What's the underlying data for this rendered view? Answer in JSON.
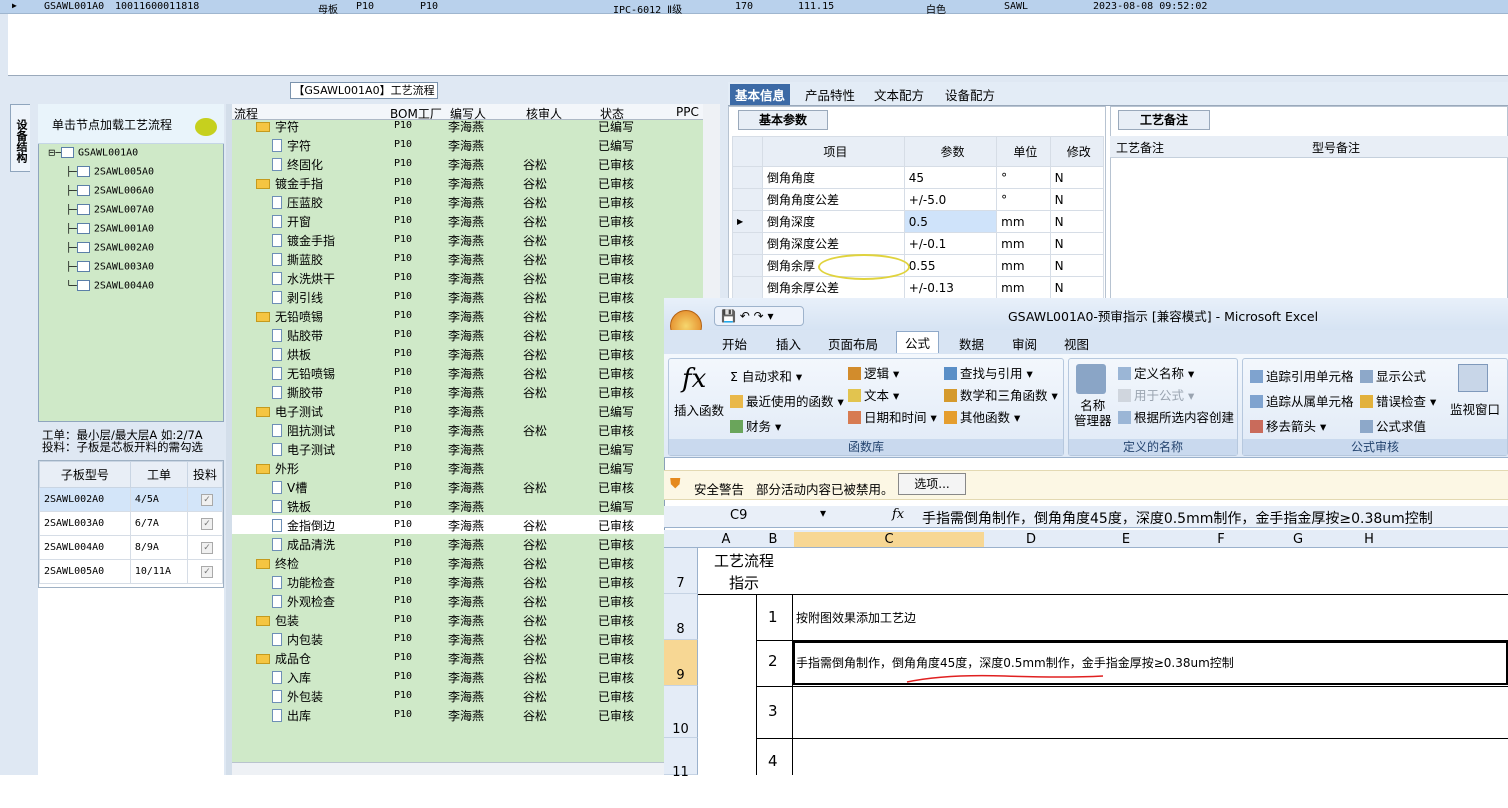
{
  "top_grid": {
    "row": [
      "GSAWL001A0",
      "10011600011818",
      "母板",
      "P10",
      "P10",
      "IPC-6012 Ⅱ级",
      "170",
      "111.15",
      "白色",
      "SAWL",
      "2023-08-08 09:52:02"
    ]
  },
  "left_panel": {
    "title": "【GSAWL001A0】工艺流程",
    "vertical_tab": "设备结构",
    "tree_header": "单击节点加载工艺流程",
    "tree": {
      "root": "GSAWL001A0",
      "children": [
        "2SAWL005A0",
        "2SAWL006A0",
        "2SAWL007A0",
        "2SAWL001A0",
        "2SAWL002A0",
        "2SAWL003A0",
        "2SAWL004A0"
      ]
    },
    "info_line1": "工单：最小层/最大层A 如:2/7A",
    "info_line2": "投料：子板是芯板开料的需勾选",
    "sub_table": {
      "headers": [
        "子板型号",
        "工单",
        "投料"
      ],
      "rows": [
        [
          "2SAWL002A0",
          "4/5A"
        ],
        [
          "2SAWL003A0",
          "6/7A"
        ],
        [
          "2SAWL004A0",
          "8/9A"
        ],
        [
          "2SAWL005A0",
          "10/11A"
        ]
      ]
    }
  },
  "process_grid": {
    "headers": [
      "流程",
      "BOM工厂",
      "编写人",
      "核审人",
      "状态",
      "PPC"
    ],
    "rows": [
      {
        "level": 1,
        "name": "字符",
        "bom": "P10",
        "writer": "李海燕",
        "reviewer": "",
        "status": "已编写"
      },
      {
        "level": 2,
        "name": "字符",
        "bom": "P10",
        "writer": "李海燕",
        "reviewer": "",
        "status": "已编写"
      },
      {
        "level": 2,
        "name": "终固化",
        "bom": "P10",
        "writer": "李海燕",
        "reviewer": "谷松",
        "status": "已审核"
      },
      {
        "level": 1,
        "name": "镀金手指",
        "bom": "P10",
        "writer": "李海燕",
        "reviewer": "谷松",
        "status": "已审核"
      },
      {
        "level": 2,
        "name": "压蓝胶",
        "bom": "P10",
        "writer": "李海燕",
        "reviewer": "谷松",
        "status": "已审核"
      },
      {
        "level": 2,
        "name": "开窗",
        "bom": "P10",
        "writer": "李海燕",
        "reviewer": "谷松",
        "status": "已审核"
      },
      {
        "level": 2,
        "name": "镀金手指",
        "bom": "P10",
        "writer": "李海燕",
        "reviewer": "谷松",
        "status": "已审核"
      },
      {
        "level": 2,
        "name": "撕蓝胶",
        "bom": "P10",
        "writer": "李海燕",
        "reviewer": "谷松",
        "status": "已审核"
      },
      {
        "level": 2,
        "name": "水洗烘干",
        "bom": "P10",
        "writer": "李海燕",
        "reviewer": "谷松",
        "status": "已审核"
      },
      {
        "level": 2,
        "name": "剥引线",
        "bom": "P10",
        "writer": "李海燕",
        "reviewer": "谷松",
        "status": "已审核"
      },
      {
        "level": 1,
        "name": "无铅喷锡",
        "bom": "P10",
        "writer": "李海燕",
        "reviewer": "谷松",
        "status": "已审核"
      },
      {
        "level": 2,
        "name": "贴胶带",
        "bom": "P10",
        "writer": "李海燕",
        "reviewer": "谷松",
        "status": "已审核"
      },
      {
        "level": 2,
        "name": "烘板",
        "bom": "P10",
        "writer": "李海燕",
        "reviewer": "谷松",
        "status": "已审核"
      },
      {
        "level": 2,
        "name": "无铅喷锡",
        "bom": "P10",
        "writer": "李海燕",
        "reviewer": "谷松",
        "status": "已审核"
      },
      {
        "level": 2,
        "name": "撕胶带",
        "bom": "P10",
        "writer": "李海燕",
        "reviewer": "谷松",
        "status": "已审核"
      },
      {
        "level": 1,
        "name": "电子测试",
        "bom": "P10",
        "writer": "李海燕",
        "reviewer": "",
        "status": "已编写"
      },
      {
        "level": 2,
        "name": "阻抗测试",
        "bom": "P10",
        "writer": "李海燕",
        "reviewer": "谷松",
        "status": "已审核"
      },
      {
        "level": 2,
        "name": "电子测试",
        "bom": "P10",
        "writer": "李海燕",
        "reviewer": "",
        "status": "已编写"
      },
      {
        "level": 1,
        "name": "外形",
        "bom": "P10",
        "writer": "李海燕",
        "reviewer": "",
        "status": "已编写"
      },
      {
        "level": 2,
        "name": "V槽",
        "bom": "P10",
        "writer": "李海燕",
        "reviewer": "谷松",
        "status": "已审核"
      },
      {
        "level": 2,
        "name": "铣板",
        "bom": "P10",
        "writer": "李海燕",
        "reviewer": "",
        "status": "已编写"
      },
      {
        "level": 2,
        "name": "金指倒边",
        "bom": "P10",
        "writer": "李海燕",
        "reviewer": "谷松",
        "status": "已审核",
        "selected": true
      },
      {
        "level": 2,
        "name": "成品清洗",
        "bom": "P10",
        "writer": "李海燕",
        "reviewer": "谷松",
        "status": "已审核"
      },
      {
        "level": 1,
        "name": "终检",
        "bom": "P10",
        "writer": "李海燕",
        "reviewer": "谷松",
        "status": "已审核"
      },
      {
        "level": 2,
        "name": "功能检查",
        "bom": "P10",
        "writer": "李海燕",
        "reviewer": "谷松",
        "status": "已审核"
      },
      {
        "level": 2,
        "name": "外观检查",
        "bom": "P10",
        "writer": "李海燕",
        "reviewer": "谷松",
        "status": "已审核"
      },
      {
        "level": 1,
        "name": "包装",
        "bom": "P10",
        "writer": "李海燕",
        "reviewer": "谷松",
        "status": "已审核"
      },
      {
        "level": 2,
        "name": "内包装",
        "bom": "P10",
        "writer": "李海燕",
        "reviewer": "谷松",
        "status": "已审核"
      },
      {
        "level": 1,
        "name": "成品仓",
        "bom": "P10",
        "writer": "李海燕",
        "reviewer": "谷松",
        "status": "已审核"
      },
      {
        "level": 2,
        "name": "入库",
        "bom": "P10",
        "writer": "李海燕",
        "reviewer": "谷松",
        "status": "已审核"
      },
      {
        "level": 2,
        "name": "外包装",
        "bom": "P10",
        "writer": "李海燕",
        "reviewer": "谷松",
        "status": "已审核"
      },
      {
        "level": 2,
        "name": "出库",
        "bom": "P10",
        "writer": "李海燕",
        "reviewer": "谷松",
        "status": "已审核"
      }
    ]
  },
  "right_panel": {
    "tabs": [
      "基本信息",
      "产品特性",
      "文本配方",
      "设备配方"
    ],
    "params_tab": "基本参数",
    "params_headers": [
      "项目",
      "参数",
      "单位",
      "修改"
    ],
    "params_rows": [
      [
        "倒角角度",
        "45",
        "°",
        "N"
      ],
      [
        "倒角角度公差",
        "+/-5.0",
        "°",
        "N"
      ],
      [
        "倒角深度",
        "0.5",
        "mm",
        "N"
      ],
      [
        "倒角深度公差",
        "+/-0.1",
        "mm",
        "N"
      ],
      [
        "倒角余厚",
        "0.55",
        "mm",
        "N"
      ],
      [
        "倒角余厚公差",
        "+/-0.13",
        "mm",
        "N"
      ]
    ],
    "notes_tab": "工艺备注",
    "notes_headers": [
      "工艺备注",
      "型号备注"
    ]
  },
  "excel": {
    "title": "GSAWL001A0-预审指示 [兼容模式] - Microsoft Excel",
    "tabs": [
      "开始",
      "插入",
      "页面布局",
      "公式",
      "数据",
      "审阅",
      "视图"
    ],
    "ribbon": {
      "insert_function": "插入函数",
      "autosum": "自动求和",
      "recent": "最近使用的函数",
      "finance": "财务",
      "logic": "逻辑",
      "text": "文本",
      "datetime": "日期和时间",
      "lookup": "查找与引用",
      "math": "数学和三角函数",
      "other": "其他函数",
      "group1": "函数库",
      "name_mgr": "名称\n管理器",
      "define_name": "定义名称",
      "use_formula": "用于公式",
      "create_sel": "根据所选内容创建",
      "group2": "定义的名称",
      "trace_prec": "追踪引用单元格",
      "trace_dep": "追踪从属单元格",
      "remove_arrows": "移去箭头",
      "show_formulas": "显示公式",
      "error_check": "错误检查",
      "eval_formula": "公式求值",
      "watch": "监视窗口",
      "group3": "公式审核"
    },
    "warning_title": "安全警告",
    "warning_text": "部分活动内容已被禁用。",
    "warning_button": "选项...",
    "name_box": "C9",
    "fx": "fx",
    "formula": "手指需倒角制作，倒角角度45度，深度0.5mm制作，金手指金厚按≥0.38um控制",
    "columns": [
      "A",
      "B",
      "C",
      "D",
      "E",
      "F",
      "G",
      "H"
    ],
    "rows": [
      {
        "num": "7",
        "label": "工艺流程\n指示"
      },
      {
        "num": "8",
        "idx": "1",
        "text": "按附图效果添加工艺边"
      },
      {
        "num": "9",
        "idx": "2",
        "text": "手指需倒角制作，倒角角度45度，深度0.5mm制作，金手指金厚按≥0.38um控制"
      },
      {
        "num": "10",
        "idx": "3",
        "text": ""
      },
      {
        "num": "11",
        "idx": "4",
        "text": ""
      }
    ]
  },
  "colors": {
    "accent": "#3c6aa6",
    "tree_bg": "#cfe9c8",
    "excel_tab": "#d8e4f3"
  }
}
